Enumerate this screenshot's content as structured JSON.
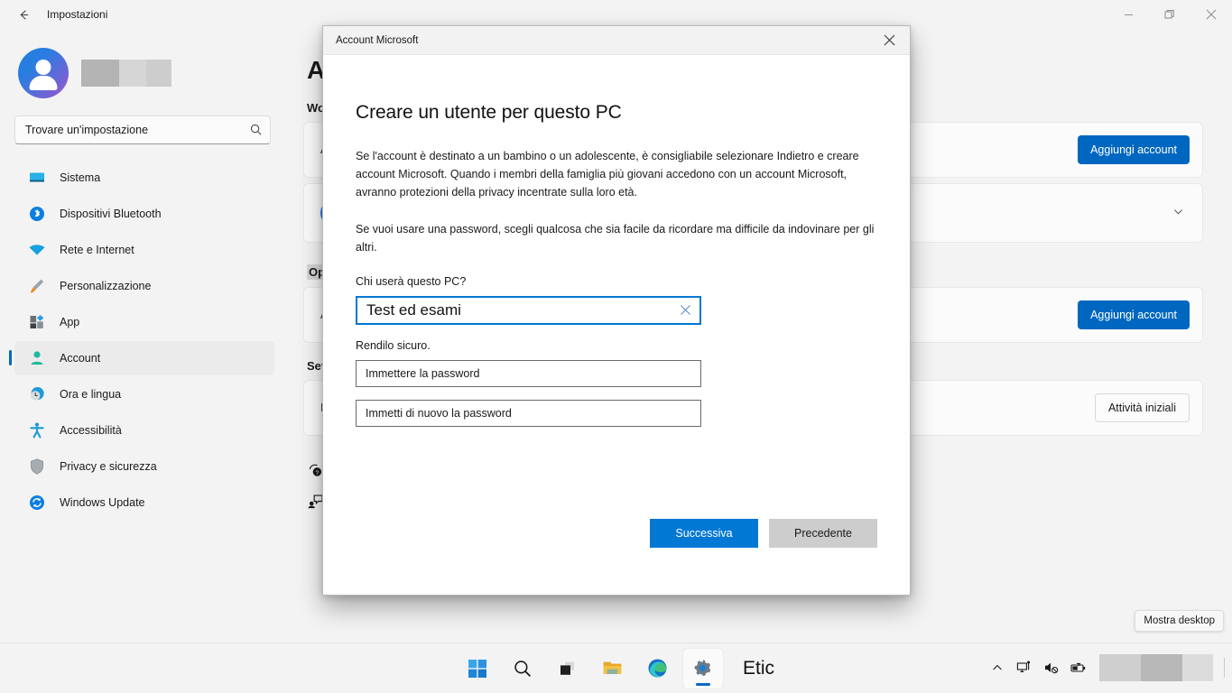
{
  "window": {
    "title": "Impostazioni",
    "back_icon": "back-arrow-icon",
    "minimize_label": "Riduci a icona",
    "restore_label": "Ripristina",
    "close_label": "Chiudi"
  },
  "sidebar": {
    "account_name_redacted": true,
    "search": {
      "placeholder": "Trovare un'impostazione",
      "value": "",
      "icon": "search-icon"
    },
    "items": [
      {
        "label": "Sistema",
        "icon": "monitor-icon",
        "color": "#2ab0e8",
        "active": false
      },
      {
        "label": "Dispositivi Bluetooth",
        "icon": "bluetooth-icon",
        "color": "#0b7ee0",
        "active": false
      },
      {
        "label": "Rete e Internet",
        "icon": "wifi-icon",
        "color": "#18a0e0",
        "active": false
      },
      {
        "label": "Personalizzazione",
        "icon": "paintbrush-icon",
        "color": "#f08a24",
        "active": false
      },
      {
        "label": "App",
        "icon": "apps-icon",
        "color": "#2f9ae8",
        "active": false
      },
      {
        "label": "Account",
        "icon": "person-icon",
        "color": "#20b9a0",
        "active": true
      },
      {
        "label": "Ora e lingua",
        "icon": "clock-globe-icon",
        "color": "#1b9ad6",
        "active": false
      },
      {
        "label": "Accessibilità",
        "icon": "accessibility-icon",
        "color": "#1b9ad6",
        "active": false
      },
      {
        "label": "Privacy e sicurezza",
        "icon": "shield-icon",
        "color": "#8a8a8a",
        "active": false
      },
      {
        "label": "Windows Update",
        "icon": "update-icon",
        "color": "#0b7ee0",
        "active": false
      }
    ]
  },
  "main": {
    "page_title": "Ac",
    "section_work": "Wor",
    "section_options": "Opzi",
    "section_settings": "Set",
    "card_a_text": "A",
    "card_b_text": "",
    "card_c_text": "A",
    "card_d_text": "I",
    "add_account_label": "Aggiungi account",
    "get_started_label": "Attività iniziali",
    "expand_icon": "chevron-down-icon",
    "footer_links": [
      {
        "label": "",
        "icon": "help-icon"
      },
      {
        "label": "",
        "icon": "feedback-icon"
      }
    ]
  },
  "dialog": {
    "title": "Account Microsoft",
    "close_icon": "close-icon",
    "heading": "Creare un utente per questo PC",
    "paragraph1": "Se l'account è destinato a un bambino o un adolescente, è consigliabile selezionare Indietro e creare account Microsoft. Quando i membri della famiglia più giovani accedono con un account Microsoft, avranno protezioni della privacy incentrate sulla loro età.",
    "paragraph2": "Se vuoi usare una password, scegli qualcosa che sia facile da ricordare ma difficile da indovinare per gli altri.",
    "name_label": "Chi userà questo PC?",
    "name_value": "Test ed esami",
    "name_clear_icon": "clear-x-icon",
    "secure_label": "Rendilo sicuro.",
    "password_placeholder": "Immettere la password",
    "password_value": "",
    "password_confirm_placeholder": "Immetti di nuovo la password",
    "password_confirm_value": "",
    "next_label": "Successiva",
    "back_label": "Precedente",
    "accent_color": "#0078d4",
    "secondary_color": "#cdcdcd"
  },
  "desktop": {
    "show_desktop_label": "Mostra desktop"
  },
  "taskbar": {
    "items": [
      {
        "name": "start-icon",
        "label": "Start",
        "active": false
      },
      {
        "name": "search-icon",
        "label": "Cerca",
        "active": false
      },
      {
        "name": "task-view-icon",
        "label": "Visualizzazione attività",
        "active": false
      },
      {
        "name": "file-explorer-icon",
        "label": "Esplora file",
        "active": false
      },
      {
        "name": "edge-icon",
        "label": "Microsoft Edge",
        "active": false
      },
      {
        "name": "settings-icon",
        "label": "Impostazioni",
        "active": true
      }
    ],
    "app_text": "Etic",
    "tray": [
      {
        "name": "chevron-up-icon",
        "label": "Mostra icone nascoste"
      },
      {
        "name": "network-icon",
        "label": "Rete"
      },
      {
        "name": "speaker-muted-icon",
        "label": "Volume disattivato"
      },
      {
        "name": "battery-icon",
        "label": "Batteria"
      }
    ],
    "clock_redacted": true
  }
}
